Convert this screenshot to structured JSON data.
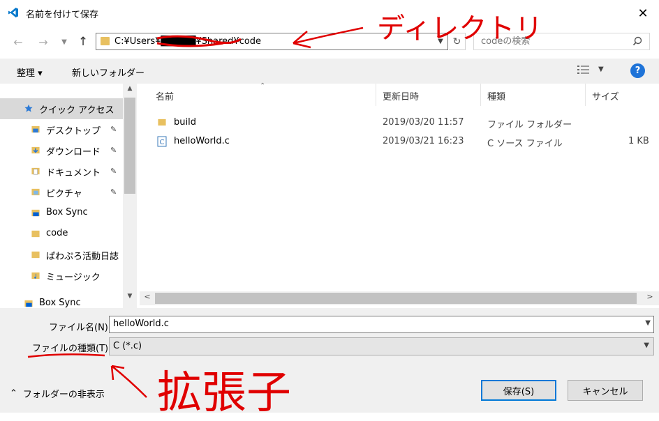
{
  "window": {
    "title": "名前を付けて保存",
    "close_glyph": "✕"
  },
  "address": {
    "path": "C:¥Users¥█████¥Shared¥code",
    "search_placeholder": "codeの検索"
  },
  "toolbar": {
    "organize_label": "整理 ▾",
    "new_folder_label": "新しいフォルダー",
    "help_label": "?"
  },
  "sidebar": {
    "items": [
      {
        "label": "クイック アクセス",
        "icon": "star-icon",
        "pinned": false
      },
      {
        "label": "デスクトップ",
        "icon": "desktop-folder-icon",
        "pinned": true
      },
      {
        "label": "ダウンロード",
        "icon": "download-folder-icon",
        "pinned": true
      },
      {
        "label": "ドキュメント",
        "icon": "documents-folder-icon",
        "pinned": true
      },
      {
        "label": "ピクチャ",
        "icon": "pictures-folder-icon",
        "pinned": true
      },
      {
        "label": "Box Sync",
        "icon": "box-sync-icon",
        "pinned": false
      },
      {
        "label": "code",
        "icon": "folder-icon",
        "pinned": false
      },
      {
        "label": "ぱわぷろ活動日誌",
        "icon": "folder-icon",
        "pinned": false
      },
      {
        "label": "ミュージック",
        "icon": "music-folder-icon",
        "pinned": false
      },
      {
        "label": "Box Sync",
        "icon": "box-sync-icon",
        "pinned": false
      }
    ],
    "pin_glyph": "📌"
  },
  "filelist": {
    "columns": [
      "名前",
      "更新日時",
      "種類",
      "サイズ"
    ],
    "rows": [
      {
        "name": "build",
        "modified": "2019/03/20 11:57",
        "type": "ファイル フォルダー",
        "size": "",
        "icon": "folder-icon"
      },
      {
        "name": "helloWorld.c",
        "modified": "2019/03/21 16:23",
        "type": "C ソース ファイル",
        "size": "1 KB",
        "icon": "c-file-icon"
      }
    ]
  },
  "form": {
    "filename_label": "ファイル名(N):",
    "filename_value": "helloWorld.c",
    "filetype_label": "ファイルの種類(T):",
    "filetype_value": "C (*.c)",
    "hide_folders_label": "フォルダーの非表示",
    "save_label": "保存(S)",
    "cancel_label": "キャンセル"
  },
  "annotations": {
    "directory_note": "ディレクトリ",
    "extension_note": "拡張子",
    "color": "#e00000"
  },
  "colors": {
    "accent": "#0078d7",
    "help": "#1e73d8",
    "folder": "#e8c060",
    "annotation": "#e00000"
  }
}
